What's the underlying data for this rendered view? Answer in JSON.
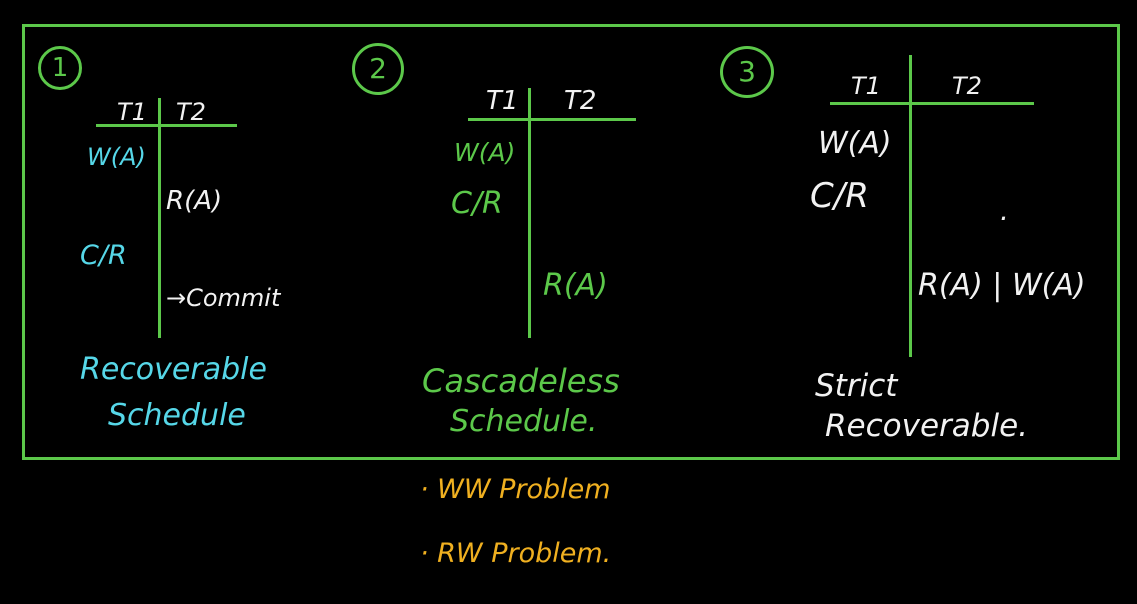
{
  "schedules": [
    {
      "number": "1",
      "col1": "T1",
      "col2": "T2",
      "ops": [
        "W(A)",
        "R(A)",
        "C/R",
        "→Commit"
      ],
      "caption_line1": "Recoverable",
      "caption_line2": "Schedule"
    },
    {
      "number": "2",
      "col1": "T1",
      "col2": "T2",
      "ops": [
        "W(A)",
        "C/R",
        "R(A)"
      ],
      "caption_line1": "Cascadeless",
      "caption_line2": "Schedule."
    },
    {
      "number": "3",
      "col1": "T1",
      "col2": "T2",
      "ops": [
        "W(A)",
        "C/R",
        ".",
        "R(A) | W(A)"
      ],
      "caption_line1": "Strict",
      "caption_line2": "Recoverable."
    }
  ],
  "notes": [
    "· WW Problem",
    "· RW Problem."
  ],
  "colors": {
    "border": "#5cc84a",
    "blue": "#56d7e8",
    "green": "#5cc84a",
    "white": "#f2f2f2",
    "orange": "#f0b020"
  }
}
